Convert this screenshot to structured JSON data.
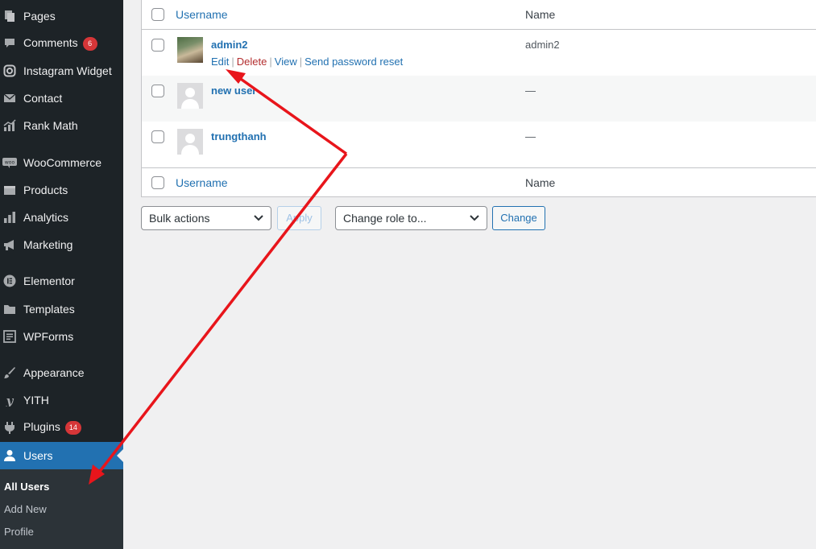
{
  "sidebar": {
    "items": [
      {
        "label": "Pages",
        "icon": "pages-icon"
      },
      {
        "label": "Comments",
        "icon": "comments-icon",
        "count": "6"
      },
      {
        "label": "Instagram Widget",
        "icon": "instagram-icon"
      },
      {
        "label": "Contact",
        "icon": "mail-icon"
      },
      {
        "label": "Rank Math",
        "icon": "rank-math-icon"
      },
      {
        "label": "WooCommerce",
        "icon": "woocommerce-icon"
      },
      {
        "label": "Products",
        "icon": "products-icon"
      },
      {
        "label": "Analytics",
        "icon": "analytics-icon"
      },
      {
        "label": "Marketing",
        "icon": "megaphone-icon"
      },
      {
        "label": "Elementor",
        "icon": "elementor-icon"
      },
      {
        "label": "Templates",
        "icon": "folder-icon"
      },
      {
        "label": "WPForms",
        "icon": "wpforms-icon"
      },
      {
        "label": "Appearance",
        "icon": "brush-icon"
      },
      {
        "label": "YITH",
        "icon": "yith-icon"
      },
      {
        "label": "Plugins",
        "icon": "plugin-icon",
        "count": "14"
      },
      {
        "label": "Users",
        "icon": "user-icon",
        "active": true
      }
    ],
    "submenu": [
      {
        "label": "All Users",
        "current": true
      },
      {
        "label": "Add New"
      },
      {
        "label": "Profile"
      }
    ]
  },
  "table": {
    "columns": {
      "username": "Username",
      "name": "Name"
    },
    "rows": [
      {
        "username": "admin2",
        "name": "admin2",
        "avatar": "photo"
      },
      {
        "username": "new user",
        "name": "—",
        "avatar": "default"
      },
      {
        "username": "trungthanh",
        "name": "—",
        "avatar": "default"
      }
    ],
    "row_actions": {
      "edit": "Edit",
      "delete": "Delete",
      "view": "View",
      "reset": "Send password reset",
      "separator": "|"
    }
  },
  "bulk": {
    "bulk_select": "Bulk actions",
    "apply_label": "Apply",
    "role_select": "Change role to...",
    "change_label": "Change"
  },
  "colors": {
    "accent": "#2271b1",
    "sidebar": "#1d2327",
    "badge": "#d63638",
    "annotation_arrow": "#e8151b"
  }
}
